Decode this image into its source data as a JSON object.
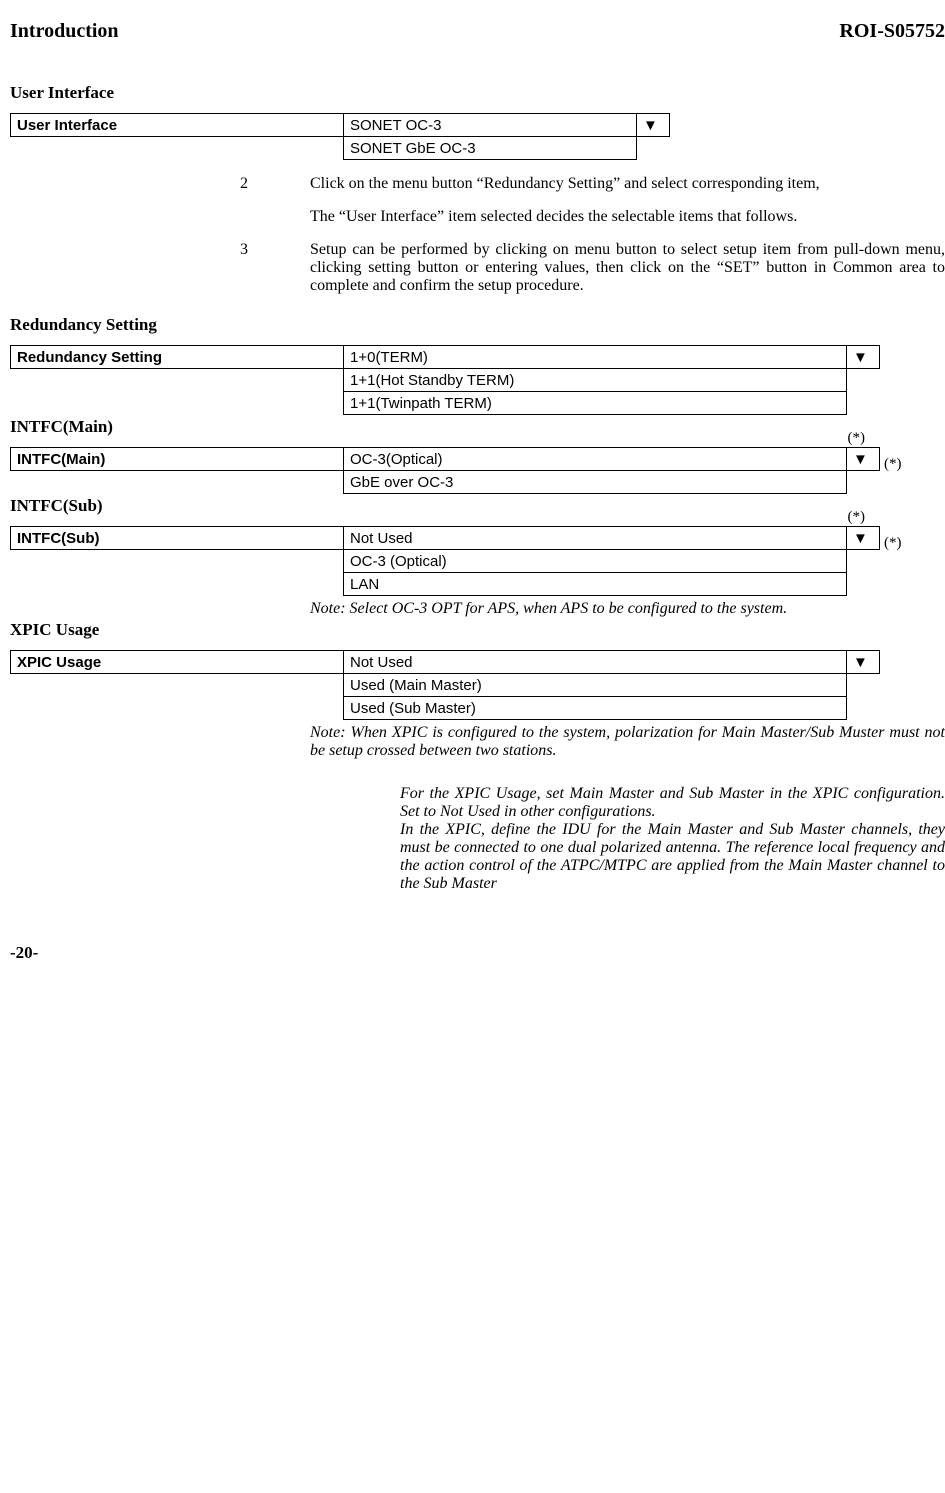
{
  "header": {
    "left": "Introduction",
    "right": "ROI-S05752"
  },
  "s1": {
    "title": "User Interface",
    "label": "User Interface",
    "opt1": "SONET OC-3",
    "opt2": "SONET GbE OC-3",
    "arrow": "▼"
  },
  "step2": {
    "num": "2",
    "text": "Click on the menu button “Redundancy Setting” and select corresponding item,",
    "para": "The “User Interface” item selected decides the selectable items that follows."
  },
  "step3": {
    "num": "3",
    "text": "Setup can be performed by clicking on menu button to select setup item from pull-down menu, clicking setting button or entering values, then click on the “SET” button in Common area to complete and confirm the setup procedure."
  },
  "s2": {
    "title": "Redundancy Setting",
    "label": "Redundancy Setting",
    "opt1": "1+0(TERM)",
    "opt2": "1+1(Hot Standby TERM)",
    "opt3": "1+1(Twinpath TERM)",
    "arrow": "▼"
  },
  "s3": {
    "title": "INTFC(Main)",
    "label": "INTFC(Main)",
    "opt1": "OC-3(Optical)",
    "opt2": "GbE over OC-3",
    "arrow": "▼",
    "star": "(*)"
  },
  "s4": {
    "title": "INTFC(Sub)",
    "label": "INTFC(Sub)",
    "opt1": "Not Used",
    "opt2": "OC-3 (Optical)",
    "opt3": "LAN",
    "arrow": "▼",
    "star": "(*)",
    "note": "Note: Select OC-3 OPT for APS, when APS to be configured to the system."
  },
  "s5": {
    "title": "XPIC Usage",
    "label": "XPIC Usage",
    "opt1": "Not Used",
    "opt2": "Used (Main Master)",
    "opt3": "Used (Sub Master)",
    "arrow": "▼",
    "noteA_label": "Note: ",
    "noteA": "When XPIC is configured to the system, polarization for Main Master/Sub Muster must not be setup crossed between two stations.",
    "noteB": "For the XPIC Usage, set Main Master and Sub Master in the XPIC configuration. Set to Not Used in other configurations.",
    "noteC": "In the XPIC, define the IDU for the Main Master and Sub Master channels, they must be connected to one dual polarized antenna. The reference local frequency and the action control of the ATPC/MTPC are applied from the Main Master channel to the Sub Master"
  },
  "footer": "-20-"
}
